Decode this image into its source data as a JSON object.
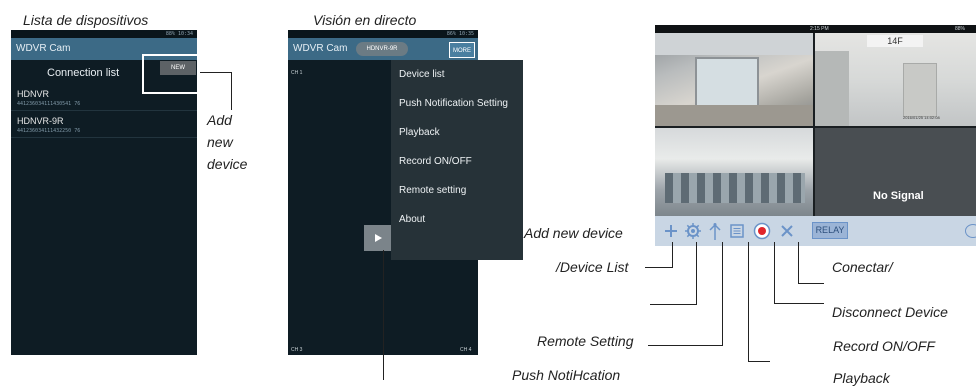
{
  "captions": {
    "device_list": "Lista de dispositivos",
    "live_view": "Visión en directo"
  },
  "screen1": {
    "status_text": "88% 10:34",
    "app_title": "WDVR Cam",
    "connection_list_label": "Connection list",
    "new_button_label": "NEW",
    "devices": [
      {
        "name": "HDNVR",
        "id": "441236034111430541 76"
      },
      {
        "name": "HDNVR-9R",
        "id": "441236034111432250 76"
      }
    ]
  },
  "screen2": {
    "status_text": "86% 10:35",
    "app_title": "WDVR Cam",
    "device_tab": "HDNVR-9R",
    "more_button_label": "MORE",
    "menu_items": [
      "Device list",
      "Push Notification Setting",
      "Playback",
      "Record ON/OFF",
      "Remote setting",
      "About"
    ],
    "channel_labels": [
      "CH 1",
      "CH 3",
      "CH 4"
    ],
    "play_icon": "play-icon"
  },
  "screen3": {
    "status_time": "2:15 PM",
    "status_battery": "88%",
    "floor_label": "14F",
    "timestamp": "2016/01/25 14:02:08",
    "no_signal_text": "No Signal",
    "relay_label": "RELAY",
    "toolbar_icons": [
      "plus-icon",
      "gear-icon",
      "antenna-icon",
      "list-icon",
      "record-icon",
      "disconnect-icon"
    ]
  },
  "annotations": {
    "add_new_device_1": "Add",
    "add_new_device_2": "new",
    "add_new_device_3": "device",
    "add_device_list_1": "Add new device",
    "add_device_list_2": "/Device List",
    "remote_setting": "Remote Setting",
    "push_notification": "Push NotiHcation",
    "conectar": "Conectar/",
    "disconnect_device": "Disconnect Device",
    "record_on_off": "Record ON/OFF",
    "playback": "Playback"
  }
}
